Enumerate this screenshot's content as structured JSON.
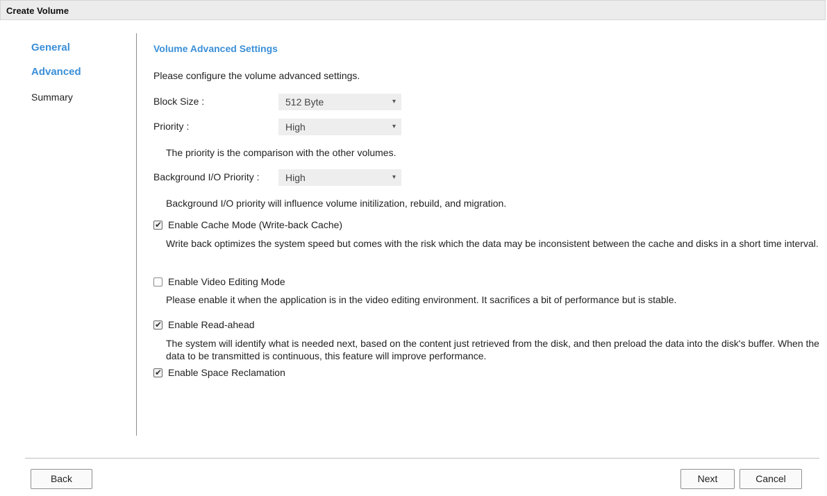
{
  "window": {
    "title": "Create Volume"
  },
  "nav": {
    "general": "General",
    "advanced": "Advanced",
    "summary": "Summary"
  },
  "section": {
    "title": "Volume Advanced Settings",
    "intro": "Please configure the volume advanced settings."
  },
  "fields": {
    "block_size": {
      "label": "Block Size :",
      "value": "512 Byte"
    },
    "priority": {
      "label": "Priority :",
      "value": "High",
      "help": "The priority is the comparison with the other volumes."
    },
    "bg_priority": {
      "label": "Background I/O Priority :",
      "value": "High",
      "help": "Background I/O priority will influence volume initilization, rebuild, and migration."
    }
  },
  "options": {
    "cache": {
      "label": "Enable Cache Mode (Write-back Cache)",
      "checked": true,
      "desc": "Write back optimizes the system speed but comes with the risk which the data may be inconsistent between the cache and disks in a short time interval."
    },
    "video": {
      "label": "Enable Video Editing Mode",
      "checked": false,
      "desc": "Please enable it when the application is in the video editing environment. It sacrifices a bit of performance but is stable."
    },
    "readahead": {
      "label": "Enable Read-ahead",
      "checked": true,
      "desc": "The system will identify what is needed next, based on the content just retrieved from the disk, and then preload the data into the disk's buffer. When the data to be transmitted is continuous, this feature will improve performance."
    },
    "reclaim": {
      "label": "Enable Space Reclamation",
      "checked": true
    }
  },
  "buttons": {
    "back": "Back",
    "next": "Next",
    "cancel": "Cancel"
  },
  "icons": {
    "dropdown": "▾",
    "check": "✔"
  },
  "colors": {
    "accent": "#3a8fd8",
    "titlebar": "#ececec",
    "select_bg": "#eeeeee"
  }
}
